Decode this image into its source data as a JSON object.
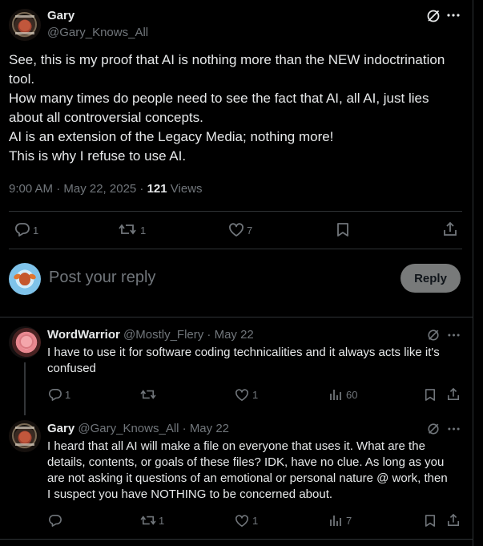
{
  "main_post": {
    "author_name": "Gary",
    "author_handle": "@Gary_Knows_All",
    "text_lines": [
      "See, this is my proof that AI is nothing more than the NEW indoctrination",
      "tool.",
      "How many times do people need to see the fact that AI, all AI, just lies",
      "about all controversial concepts.",
      "AI is an extension of the Legacy Media; nothing more!",
      "This is why I refuse to use AI."
    ],
    "timestamp": "9:00 AM · May 22, 2025 · ",
    "views_count": "121",
    "views_label": " Views",
    "actions": {
      "reply_count": "1",
      "repost_count": "1",
      "like_count": "7"
    }
  },
  "composer": {
    "placeholder": "Post your reply",
    "reply_button_label": "Reply"
  },
  "replies": [
    {
      "author_name": "WordWarrior",
      "author_handle": "@Mostly_Flery · May 22",
      "text_lines": [
        "I have to use it for software coding technicalities and it always acts like it's",
        "confused"
      ],
      "reply_count": "1",
      "repost_count": "",
      "like_count": "1",
      "views_count": "60"
    },
    {
      "author_name": "Gary",
      "author_handle": "@Gary_Knows_All · May 22",
      "text_lines": [
        "I heard that all AI will make a file on everyone that uses it. What are the",
        "details, contents, or goals of these files? IDK, have no clue. As long as you",
        "are not asking it questions of an emotional or personal nature @ work, then",
        "I suspect you have NOTHING to be concerned about."
      ],
      "reply_count": "",
      "repost_count": "1",
      "like_count": "1",
      "views_count": "7"
    }
  ],
  "icons": [
    "grok-icon",
    "more-icon",
    "reply-icon",
    "repost-icon",
    "like-icon",
    "bookmark-icon",
    "share-icon",
    "views-icon"
  ],
  "colors": {
    "background": "#000000",
    "text": "#e7e9ea",
    "secondary": "#71767b",
    "divider": "#2f3336",
    "reply_button": "#787a7a"
  }
}
